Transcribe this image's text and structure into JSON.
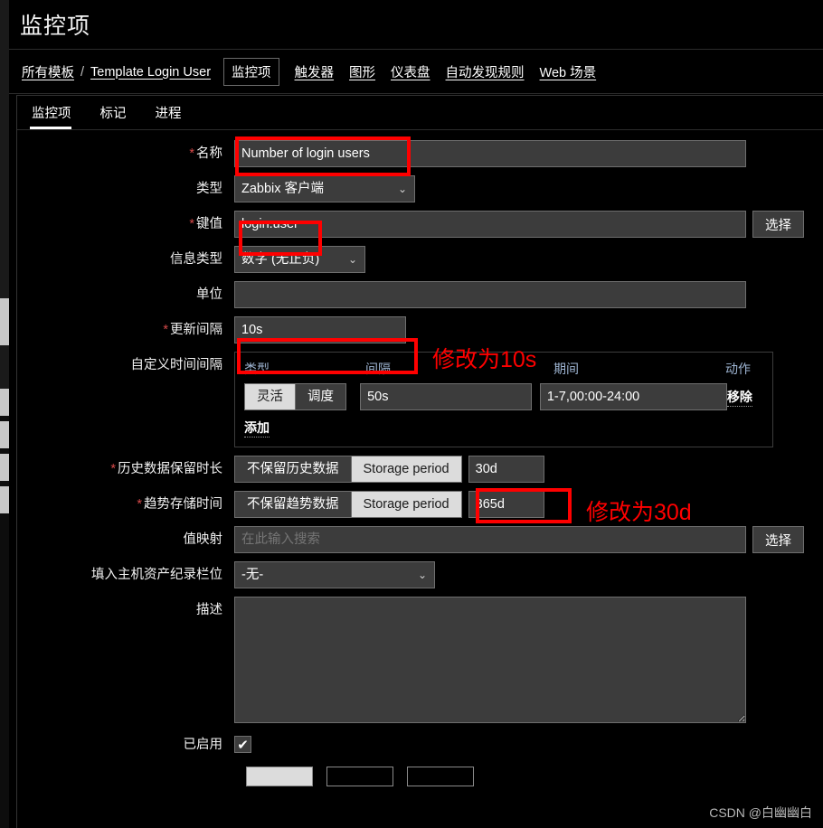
{
  "header": {
    "title": "监控项"
  },
  "breadcrumb": {
    "all_templates": "所有模板",
    "separator": "/",
    "template_name": "Template Login User",
    "items": [
      {
        "label": "监控项",
        "active": true
      },
      {
        "label": "触发器",
        "active": false
      },
      {
        "label": "图形",
        "active": false
      },
      {
        "label": "仪表盘",
        "active": false
      },
      {
        "label": "自动发现规则",
        "active": false
      },
      {
        "label": "Web 场景",
        "active": false
      }
    ]
  },
  "tabs": [
    {
      "label": "监控项",
      "active": true
    },
    {
      "label": "标记",
      "active": false
    },
    {
      "label": "进程",
      "active": false
    }
  ],
  "form": {
    "name": {
      "label": "名称",
      "required": true,
      "value": "Number of login users"
    },
    "type": {
      "label": "类型",
      "required": false,
      "value": "Zabbix 客户端"
    },
    "key": {
      "label": "键值",
      "required": true,
      "value": "login.user",
      "select_button": "选择"
    },
    "info_type": {
      "label": "信息类型",
      "required": false,
      "value": "数字 (无正负)"
    },
    "units": {
      "label": "单位",
      "required": false,
      "value": ""
    },
    "update_interval": {
      "label": "更新间隔",
      "required": true,
      "value": "10s"
    },
    "custom_intervals": {
      "label": "自定义时间间隔",
      "columns": {
        "type": "类型",
        "interval": "间隔",
        "period": "期间",
        "action": "动作"
      },
      "rows": [
        {
          "type_options": [
            {
              "label": "灵活",
              "selected": true
            },
            {
              "label": "调度",
              "selected": false
            }
          ],
          "interval": "50s",
          "period": "1-7,00:00-24:00",
          "action": "移除"
        }
      ],
      "add_link": "添加"
    },
    "history": {
      "label": "历史数据保留时长",
      "required": true,
      "options": [
        {
          "label": "不保留历史数据",
          "selected": false
        },
        {
          "label": "Storage period",
          "selected": true
        }
      ],
      "value": "30d"
    },
    "trends": {
      "label": "趋势存储时间",
      "required": true,
      "options": [
        {
          "label": "不保留趋势数据",
          "selected": false
        },
        {
          "label": "Storage period",
          "selected": true
        }
      ],
      "value": "365d"
    },
    "value_map": {
      "label": "值映射",
      "required": false,
      "value": "",
      "placeholder": "在此输入搜索",
      "select_button": "选择"
    },
    "asset_field": {
      "label": "填入主机资产纪录栏位",
      "required": false,
      "value": "-无-"
    },
    "description": {
      "label": "描述",
      "required": false,
      "value": "",
      "placeholder": ""
    },
    "enabled": {
      "label": "已启用",
      "checked": true,
      "check_glyph": "✔"
    }
  },
  "annotations": [
    {
      "text": "修改为10s",
      "color": "#ff0000"
    },
    {
      "text": "修改为30d",
      "color": "#ff0000"
    }
  ],
  "watermark": {
    "text": "CSDN @白幽幽白"
  },
  "icons": {
    "chevron_down": "⌄",
    "required_marker": "*"
  }
}
